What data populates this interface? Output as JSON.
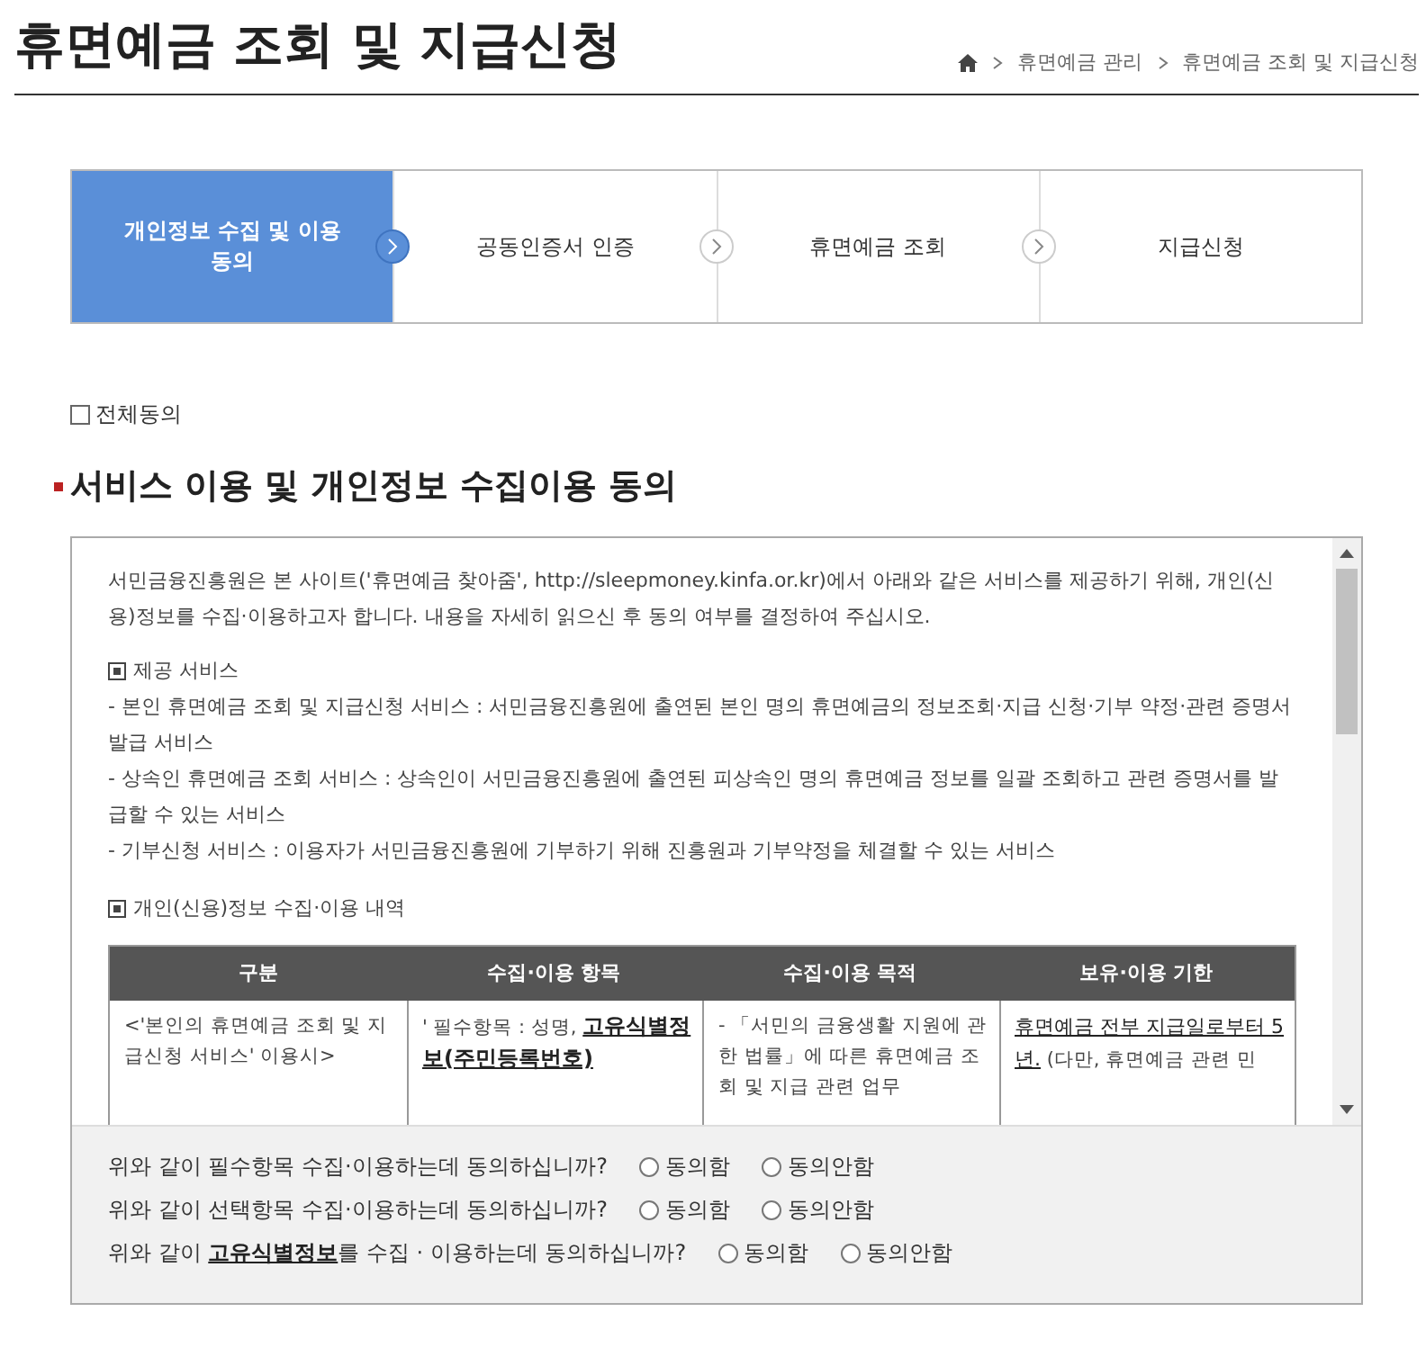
{
  "page_title": "휴면예금 조회 및 지급신청",
  "breadcrumb": [
    "휴면예금 관리",
    "휴면예금 조회 및 지급신청"
  ],
  "steps": [
    {
      "label": "개인정보 수집 및 이용동의",
      "selected": true
    },
    {
      "label": "공동인증서 인증",
      "selected": false
    },
    {
      "label": "휴면예금 조회",
      "selected": false
    },
    {
      "label": "지급신청",
      "selected": false
    }
  ],
  "agree_all": {
    "label": "전체동의",
    "checked": false
  },
  "section_title": "서비스 이용 및 개인정보 수집이용 동의",
  "intro": "서민금융진흥원은 본 사이트('휴면예금 찾아줌', http://sleepmoney.kinfa.or.kr)에서 아래와 같은 서비스를 제공하기 위해, 개인(신용)정보를 수집·이용하고자 합니다. 내용을 자세히 읽으신 후 동의 여부를 결정하여 주십시오.",
  "services": {
    "heading": "제공 서비스",
    "items": [
      "- 본인 휴면예금 조회 및 지급신청 서비스 : 서민금융진흥원에 출연된 본인 명의 휴면예금의 정보조회·지급 신청·기부 약정·관련 증명서 발급 서비스",
      "- 상속인 휴면예금 조회 서비스 : 상속인이 서민금융진흥원에 출연된 피상속인 명의 휴면예금 정보를 일괄 조회하고 관련 증명서를 발급할 수 있는 서비스",
      "- 기부신청 서비스 : 이용자가 서민금융진흥원에 기부하기 위해 진흥원과 기부약정을 체결할 수 있는 서비스"
    ]
  },
  "table": {
    "heading": "개인(신용)정보 수집·이용 내역",
    "columns": [
      "구분",
      "수집·이용 항목",
      "수집·이용 목적",
      "보유·이용 기한"
    ],
    "rows": [
      [
        [
          {
            "text": "<'본인의 휴면예금 조회 및 지급신청 서비스' 이용시>",
            "kind": "plain"
          }
        ],
        [
          {
            "text": "' 필수항목 : 성명, ",
            "kind": "plain"
          },
          {
            "text": "고유식별정보(주민등록번호)",
            "kind": "strong"
          }
        ],
        [
          {
            "text": "- 「서민의 금융생활 지원에 관한 법률」에 따른 휴면예금 조회 및 지급 관련 업무",
            "kind": "plain"
          }
        ],
        [
          {
            "text": "휴면예금 전부 지급일로부터 5년.",
            "kind": "underline"
          },
          {
            "text": " (다만, 휴면예금 관련 민",
            "kind": "plain"
          }
        ]
      ]
    ]
  },
  "questions": [
    {
      "text": "위와 같이 필수항목 수집·이용하는데 동의하십니까?",
      "options": [
        {
          "label": "동의함",
          "selected": false
        },
        {
          "label": "동의안함",
          "selected": false
        }
      ]
    },
    {
      "text": "위와 같이 선택항목 수집·이용하는데 동의하십니까?",
      "options": [
        {
          "label": "동의함",
          "selected": false
        },
        {
          "label": "동의안함",
          "selected": false
        }
      ]
    },
    {
      "text": "위와 같이 **고유식별정보**를 수집 · 이용하는데 동의하십니까?",
      "options": [
        {
          "label": "동의함",
          "selected": false
        },
        {
          "label": "동의안함",
          "selected": false
        }
      ]
    }
  ]
}
